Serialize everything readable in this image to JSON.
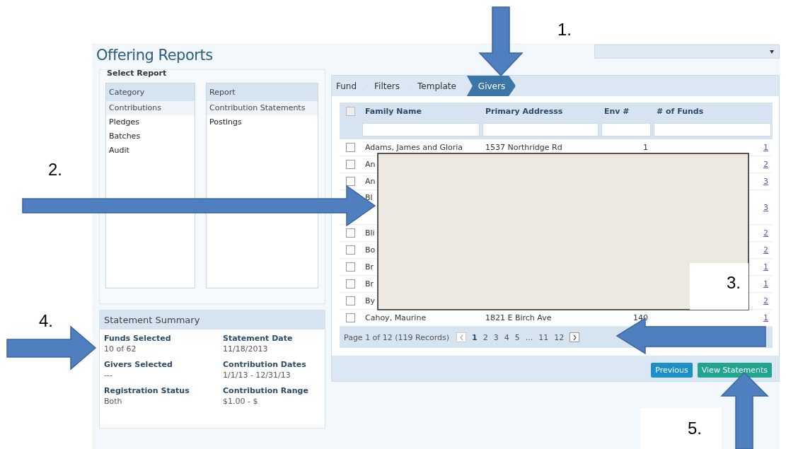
{
  "page_title": "Offering Reports",
  "select_report": {
    "legend": "Select Report",
    "category": {
      "header": "Category",
      "items": [
        {
          "label": "Contributions",
          "selected": true
        },
        {
          "label": "Pledges",
          "selected": false
        },
        {
          "label": "Batches",
          "selected": false
        },
        {
          "label": "Audit",
          "selected": false
        }
      ]
    },
    "report": {
      "header": "Report",
      "items": [
        {
          "label": "Contribution Statements",
          "selected": true
        },
        {
          "label": "Postings",
          "selected": false
        }
      ]
    }
  },
  "summary": {
    "title": "Statement Summary",
    "fields": [
      {
        "label": "Funds Selected",
        "value": "10 of 62"
      },
      {
        "label": "Statement Date",
        "value": "11/18/2013"
      },
      {
        "label": "Givers Selected",
        "value": "---"
      },
      {
        "label": "Contribution Dates",
        "value": "1/1/13 - 12/31/13"
      },
      {
        "label": "Registration Status",
        "value": "Both"
      },
      {
        "label": "Contribution Range",
        "value": "$1.00 - $"
      }
    ]
  },
  "wizard": {
    "steps": [
      {
        "label": "Fund",
        "selected": false
      },
      {
        "label": "Filters",
        "selected": false
      },
      {
        "label": "Template",
        "selected": false
      },
      {
        "label": "Givers",
        "selected": true
      }
    ]
  },
  "table": {
    "select_all_checked": false,
    "columns": [
      "Family Name",
      "Primary Addresss",
      "Env #",
      "# of Funds"
    ],
    "rows": [
      {
        "checked": false,
        "family_name": "Adams, James and Gloria",
        "address": "1537 Northridge Rd",
        "env": "1",
        "funds": "1"
      },
      {
        "checked": false,
        "family_name": "An",
        "funds": "2"
      },
      {
        "checked": false,
        "family_name": "An",
        "funds": "3"
      },
      {
        "family_name": "Bl",
        "funds": "3"
      },
      {
        "checked": false,
        "family_name": "Bli",
        "funds": "2"
      },
      {
        "checked": false,
        "family_name": "Bo",
        "funds": "2"
      },
      {
        "checked": false,
        "family_name": "Br",
        "funds": "1"
      },
      {
        "checked": false,
        "family_name": "Br",
        "funds": "1"
      },
      {
        "checked": false,
        "family_name": "By",
        "funds": "2"
      },
      {
        "checked": false,
        "family_name": "Cahoy, Maurine",
        "address": "1821 E Birch Ave",
        "env": "140",
        "funds": "1"
      }
    ]
  },
  "pager": {
    "summary": "Page 1 of 12 (119 Records)",
    "pages": [
      {
        "label": "1",
        "selected": true
      },
      {
        "label": "2",
        "selected": false
      },
      {
        "label": "3",
        "selected": false
      },
      {
        "label": "4",
        "selected": false
      },
      {
        "label": "5",
        "selected": false
      },
      {
        "label": "...",
        "selected": false
      },
      {
        "label": "11",
        "selected": false
      },
      {
        "label": "12",
        "selected": false
      }
    ]
  },
  "buttons": [
    {
      "label": "Previous",
      "kind": "primary"
    },
    {
      "label": "View Statements",
      "kind": "success"
    }
  ],
  "callouts": [
    {
      "label": "1."
    },
    {
      "label": "2."
    },
    {
      "label": "3."
    },
    {
      "label": "4."
    },
    {
      "label": "5."
    }
  ]
}
